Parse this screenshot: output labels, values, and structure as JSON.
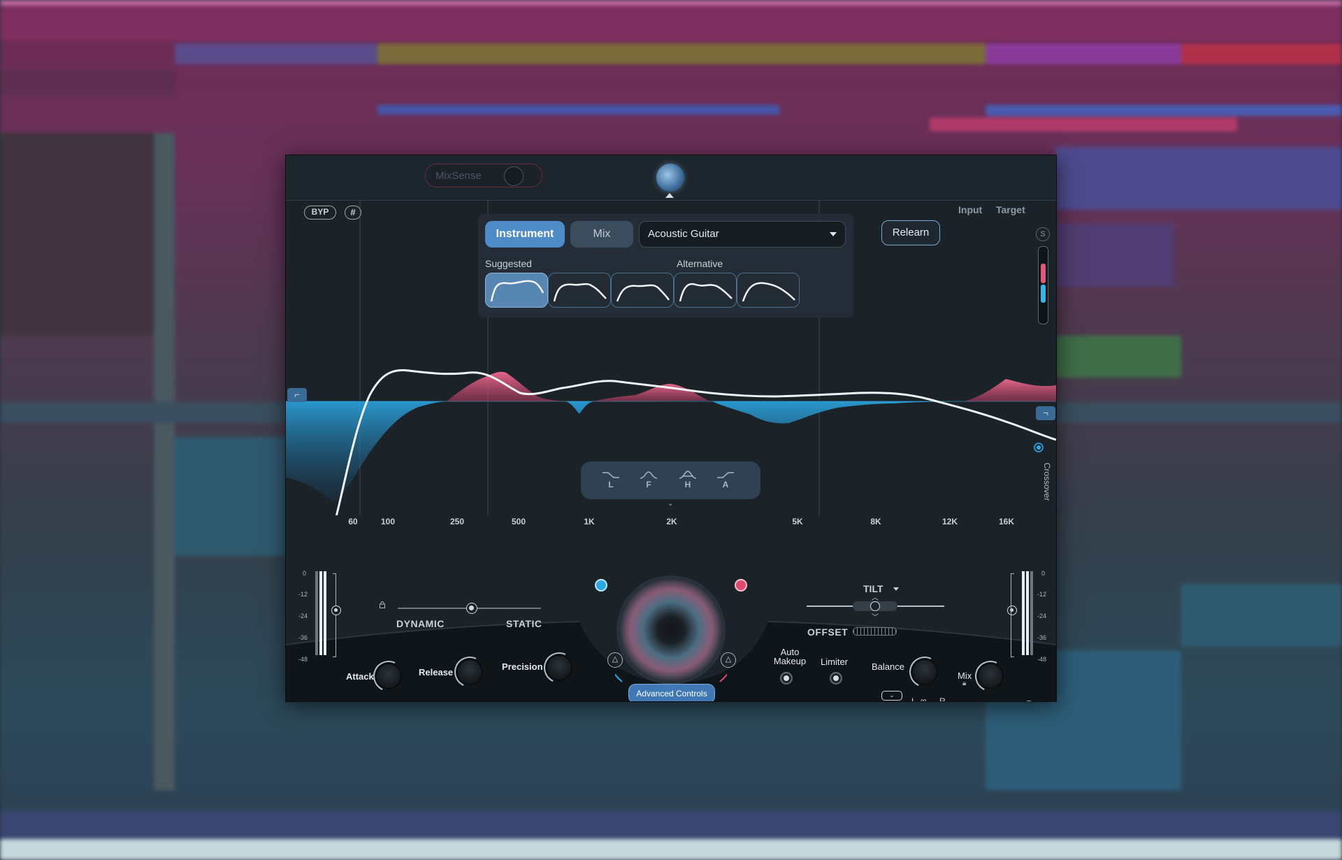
{
  "topbar": {
    "mixsense_label": "MixSense"
  },
  "graph": {
    "byp_label": "BYP",
    "grid_label": "#",
    "input_label": "Input",
    "target_label": "Target",
    "solo_label": "S",
    "crossover_label": "Crossover",
    "freq_labels": [
      "60",
      "100",
      "250",
      "500",
      "1K",
      "2K",
      "5K",
      "8K",
      "12K",
      "16K"
    ]
  },
  "profile": {
    "tab_instrument": "Instrument",
    "tab_mix": "Mix",
    "selected_instrument": "Acoustic Guitar",
    "suggested_label": "Suggested",
    "alternative_label": "Alternative",
    "relearn_label": "Relearn"
  },
  "shape_selector": {
    "shapes": [
      "L",
      "F",
      "H",
      "A"
    ]
  },
  "controls": {
    "meter_scale": [
      "0",
      "-12",
      "-24",
      "-36",
      "-48"
    ],
    "dynamic_label": "DYNAMIC",
    "static_label": "STATIC",
    "advanced_label": "Advanced Controls",
    "tilt_label": "TILT",
    "offset_label": "OFFSET",
    "attack_label": "Attack",
    "release_label": "Release",
    "precision_label": "Precision",
    "auto_makeup_label": "Auto Makeup",
    "limiter_label": "Limiter",
    "balance_label": "Balance",
    "balance_l": "L",
    "balance_r": "R",
    "mix_label": "Mix"
  },
  "colors": {
    "accent_blue": "#4f8cc7",
    "boost_pink": "#e05b80",
    "cut_blue": "#2fa7dd"
  }
}
